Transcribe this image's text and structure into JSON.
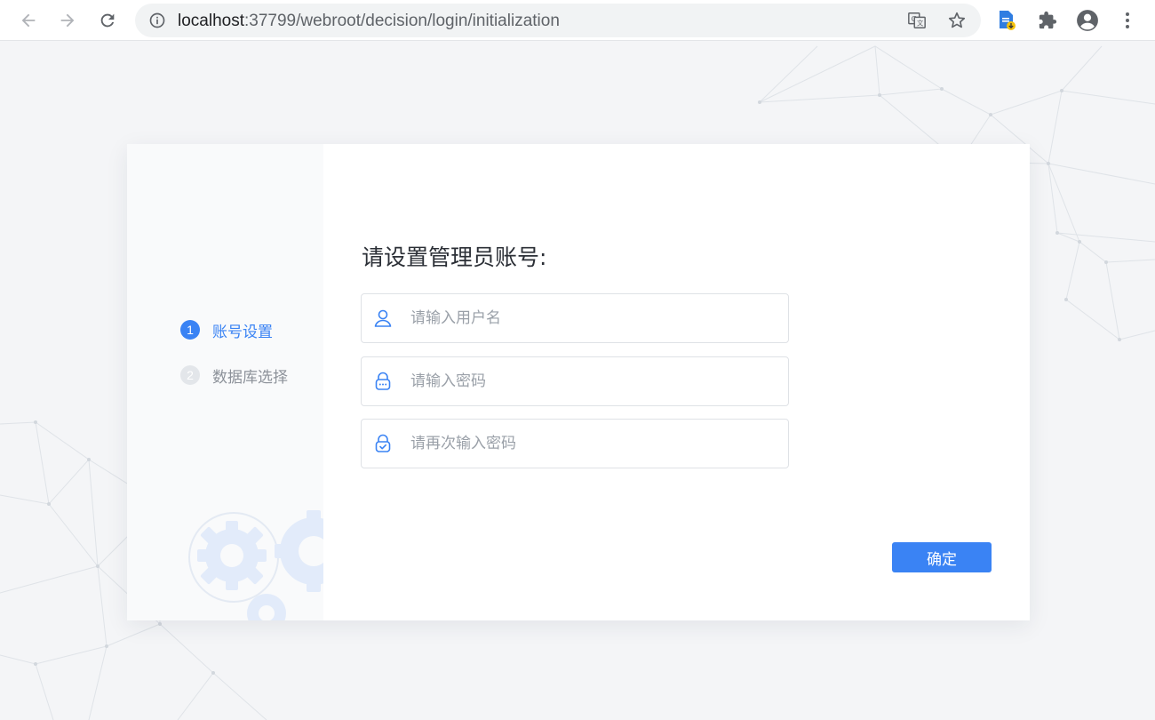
{
  "browser": {
    "url_host": "localhost",
    "url_rest": ":37799/webroot/decision/login/initialization"
  },
  "form": {
    "title": "请设置管理员账号:",
    "username_placeholder": "请输入用户名",
    "password_placeholder": "请输入密码",
    "confirm_password_placeholder": "请再次输入密码",
    "confirm_label": "确定"
  },
  "steps": [
    {
      "number": "1",
      "label": "账号设置",
      "state": "active"
    },
    {
      "number": "2",
      "label": "数据库选择",
      "state": "inactive"
    }
  ],
  "colors": {
    "accent": "#3a83f4",
    "inactive_step": "#e3e6ea",
    "page_bg": "#f4f5f7"
  }
}
